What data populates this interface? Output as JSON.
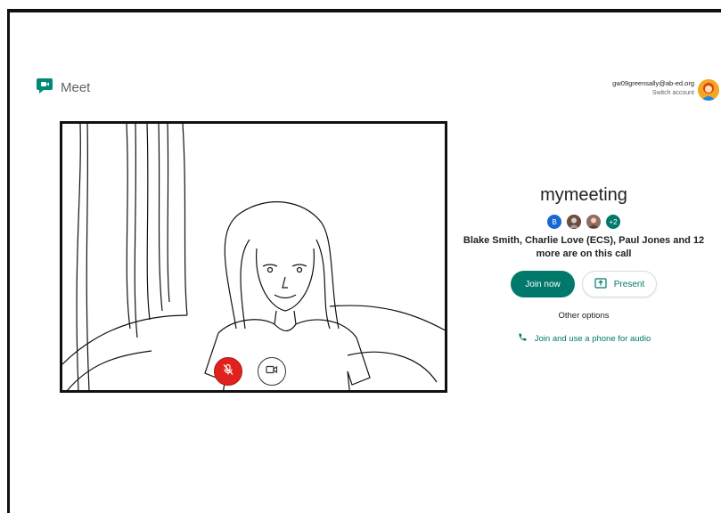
{
  "app": {
    "name": "Meet"
  },
  "account": {
    "email": "gw09greensally@ab-ed.org",
    "switch_label": "Switch account"
  },
  "meeting": {
    "title": "mymeeting",
    "participants": [
      {
        "initial": "B",
        "color": "#1967d2"
      },
      {
        "initial": "",
        "color": "#6d4c41"
      },
      {
        "initial": "",
        "color": "#8d6e63"
      },
      {
        "initial": "+2",
        "color": "#00796b"
      }
    ],
    "description": "Blake Smith, Charlie Love (ECS), Paul Jones and 12 more are on this call"
  },
  "actions": {
    "join_label": "Join now",
    "present_label": "Present",
    "other_options": "Other options",
    "phone_label": "Join and use a phone for audio"
  },
  "controls": {
    "mic_state": "muted",
    "camera_state": "on"
  },
  "colors": {
    "accent": "#00796b",
    "mic_red": "#e0211d"
  },
  "icons": [
    "meet-logo-icon",
    "mic-off-icon",
    "camera-icon",
    "present-icon",
    "phone-icon"
  ]
}
